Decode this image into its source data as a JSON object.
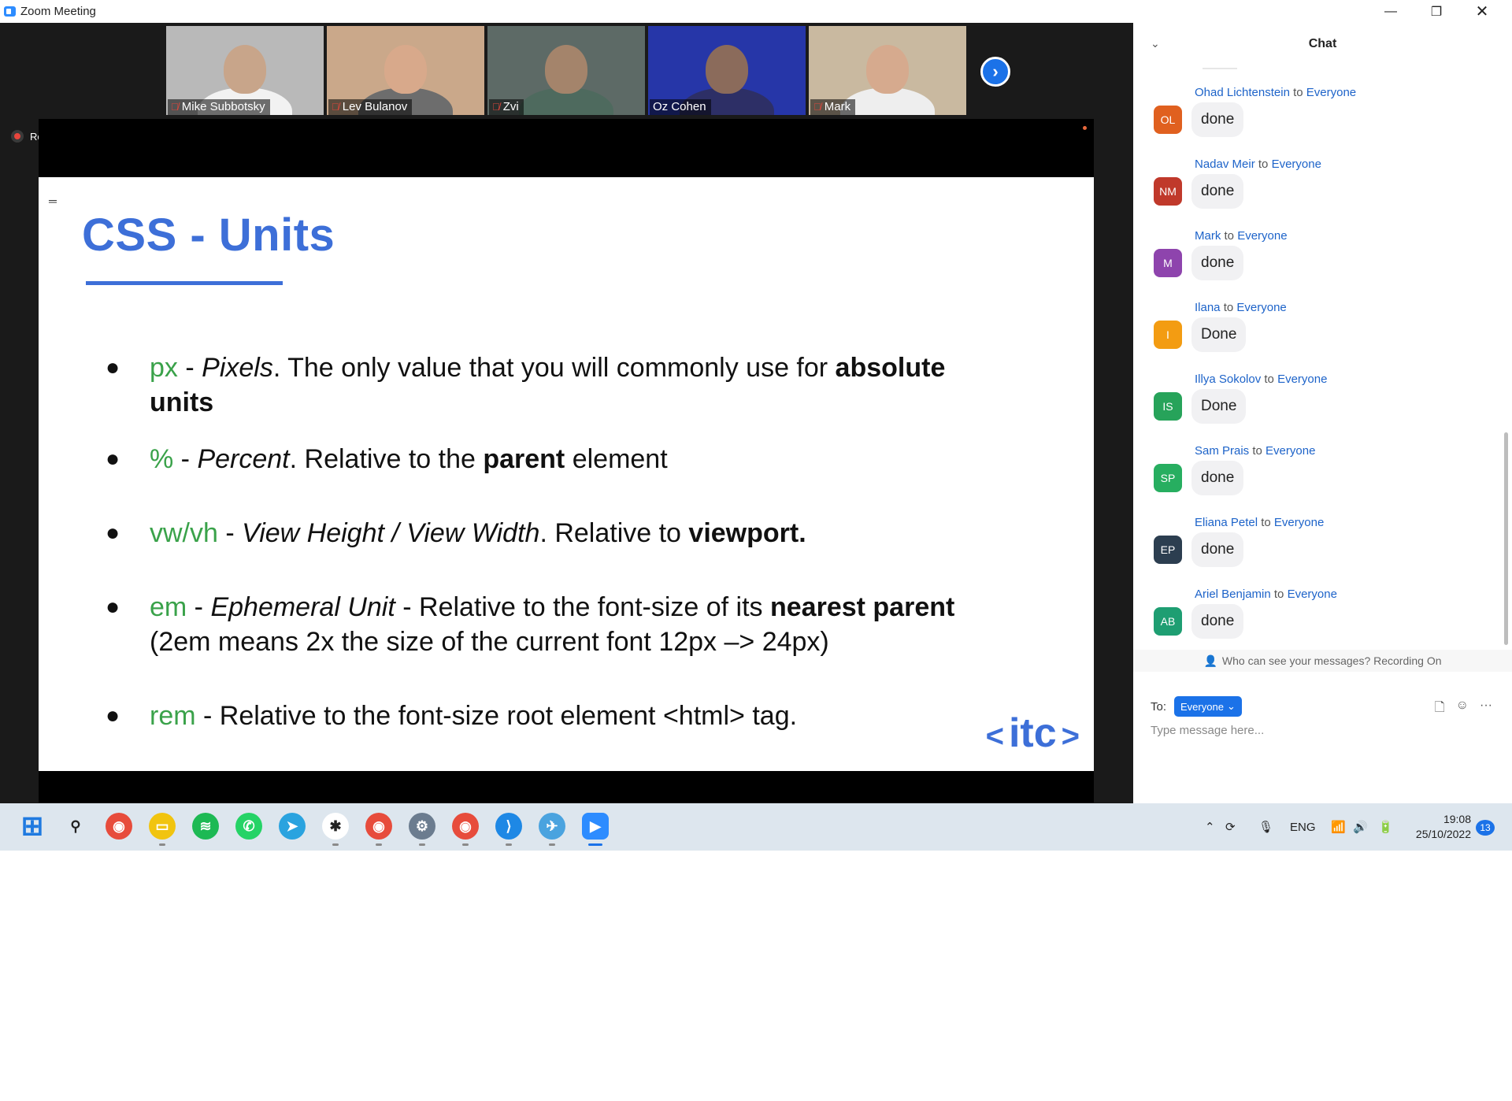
{
  "window": {
    "title": "Zoom Meeting"
  },
  "participants": [
    {
      "name": "Mike Subbotsky",
      "muted": true,
      "active": false,
      "bg": "#b9b9b9",
      "skin": "#c8a58a",
      "shirt": "#f2f2f2"
    },
    {
      "name": "Lev Bulanov",
      "muted": true,
      "active": false,
      "bg": "#caa88a",
      "skin": "#d8a98b",
      "shirt": "#6d6d6d"
    },
    {
      "name": "Zvi",
      "muted": true,
      "active": false,
      "bg": "#5d6a66",
      "skin": "#a4846b",
      "shirt": "#4e6a5e"
    },
    {
      "name": "Oz Cohen",
      "muted": false,
      "active": true,
      "bg": "#2636a8",
      "skin": "#8b6b5b",
      "shirt": "#2d2f66"
    },
    {
      "name": "Mark",
      "muted": true,
      "active": false,
      "bg": "#c9b9a0",
      "skin": "#d6aa8e",
      "shirt": "#eeeeee"
    }
  ],
  "recording": {
    "label": "Recording"
  },
  "slide": {
    "title": "CSS - Units",
    "bullets": [
      {
        "term": "px",
        "pre": " - ",
        "italic": "Pixels",
        "mid": ". The only value that you will commonly use for ",
        "bold": "absolute units",
        "post": ""
      },
      {
        "term": "%",
        "pre": " - ",
        "italic": "Percent",
        "mid": ". Relative to the ",
        "bold": "parent",
        "post": " element"
      },
      {
        "term": "vw/vh",
        "pre": " - ",
        "italic": "View  Height / View Width",
        "mid": ". Relative to ",
        "bold": "viewport.",
        "post": ""
      },
      {
        "term": "em",
        "pre": " - ",
        "italic": "Ephemeral Unit",
        "mid": " - Relative to the font-size of its ",
        "bold": "nearest parent",
        "post": " (2em means 2x the size of the current font 12px –> 24px)"
      },
      {
        "term": "rem",
        "pre": " - Relative to the font-size root element <html> tag.",
        "italic": "",
        "mid": "",
        "bold": "",
        "post": ""
      }
    ],
    "logo": {
      "left": "<",
      "text": "itc",
      "right": ">"
    }
  },
  "chat": {
    "title": "Chat",
    "messages": [
      {
        "sender": "Ohad Lichtenstein",
        "to_word": " to ",
        "recipient": "Everyone",
        "initials": "OL",
        "color": "#e0601f",
        "text": "done"
      },
      {
        "sender": "Nadav Meir",
        "to_word": " to ",
        "recipient": "Everyone",
        "initials": "NM",
        "color": "#c0392b",
        "text": "done"
      },
      {
        "sender": "Mark",
        "to_word": " to ",
        "recipient": "Everyone",
        "initials": "M",
        "color": "#8e44ad",
        "text": "done"
      },
      {
        "sender": "Ilana",
        "to_word": " to ",
        "recipient": "Everyone",
        "initials": "I",
        "color": "#f39c12",
        "text": "Done"
      },
      {
        "sender": "Illya Sokolov",
        "to_word": " to ",
        "recipient": "Everyone",
        "initials": "IS",
        "color": "#27a35a",
        "text": "Done"
      },
      {
        "sender": "Sam Prais",
        "to_word": " to ",
        "recipient": "Everyone",
        "initials": "SP",
        "color": "#27ae60",
        "text": "done"
      },
      {
        "sender": "Eliana Petel",
        "to_word": " to ",
        "recipient": "Everyone",
        "initials": "EP",
        "color": "#2c3e50",
        "text": "done"
      },
      {
        "sender": "Ariel Benjamin",
        "to_word": " to ",
        "recipient": "Everyone",
        "initials": "AB",
        "color": "#1e9e72",
        "text": "done"
      }
    ],
    "privacy_note": "Who can see your messages? Recording On",
    "to_label": "To:",
    "to_value": "Everyone",
    "input_placeholder": "Type message here..."
  },
  "taskbar": {
    "apps": [
      {
        "name": "windows-start-icon",
        "bg": "#1f7ae0",
        "glyph": "⊞",
        "running": false
      },
      {
        "name": "search-icon",
        "bg": "transparent",
        "glyph": "⚲",
        "running": false
      },
      {
        "name": "chrome-icon",
        "bg": "#e74c3c",
        "glyph": "◉",
        "running": false
      },
      {
        "name": "file-explorer-icon",
        "bg": "#f1c40f",
        "glyph": "▭",
        "running": true
      },
      {
        "name": "spotify-icon",
        "bg": "#1db954",
        "glyph": "≋",
        "running": false
      },
      {
        "name": "whatsapp-icon",
        "bg": "#25d366",
        "glyph": "✆",
        "running": false
      },
      {
        "name": "telegram-icon",
        "bg": "#2aa3df",
        "glyph": "➤",
        "running": false
      },
      {
        "name": "slack-icon",
        "bg": "#ffffff",
        "glyph": "✱",
        "running": true
      },
      {
        "name": "chrome-profile-icon",
        "bg": "#e74c3c",
        "glyph": "◉",
        "running": true
      },
      {
        "name": "settings-icon",
        "bg": "#6b7c8f",
        "glyph": "⚙",
        "running": true
      },
      {
        "name": "chrome-alt-icon",
        "bg": "#e74c3c",
        "glyph": "◉",
        "running": true
      },
      {
        "name": "vscode-icon",
        "bg": "#1e88e5",
        "glyph": "⟩",
        "running": true
      },
      {
        "name": "network-tool-icon",
        "bg": "#4aa3df",
        "glyph": "✈",
        "running": true
      },
      {
        "name": "zoom-icon",
        "bg": "#2d8cff",
        "glyph": "▶",
        "running": true
      }
    ],
    "language": "ENG",
    "time": "19:08",
    "date": "25/10/2022",
    "notifications": "13"
  }
}
